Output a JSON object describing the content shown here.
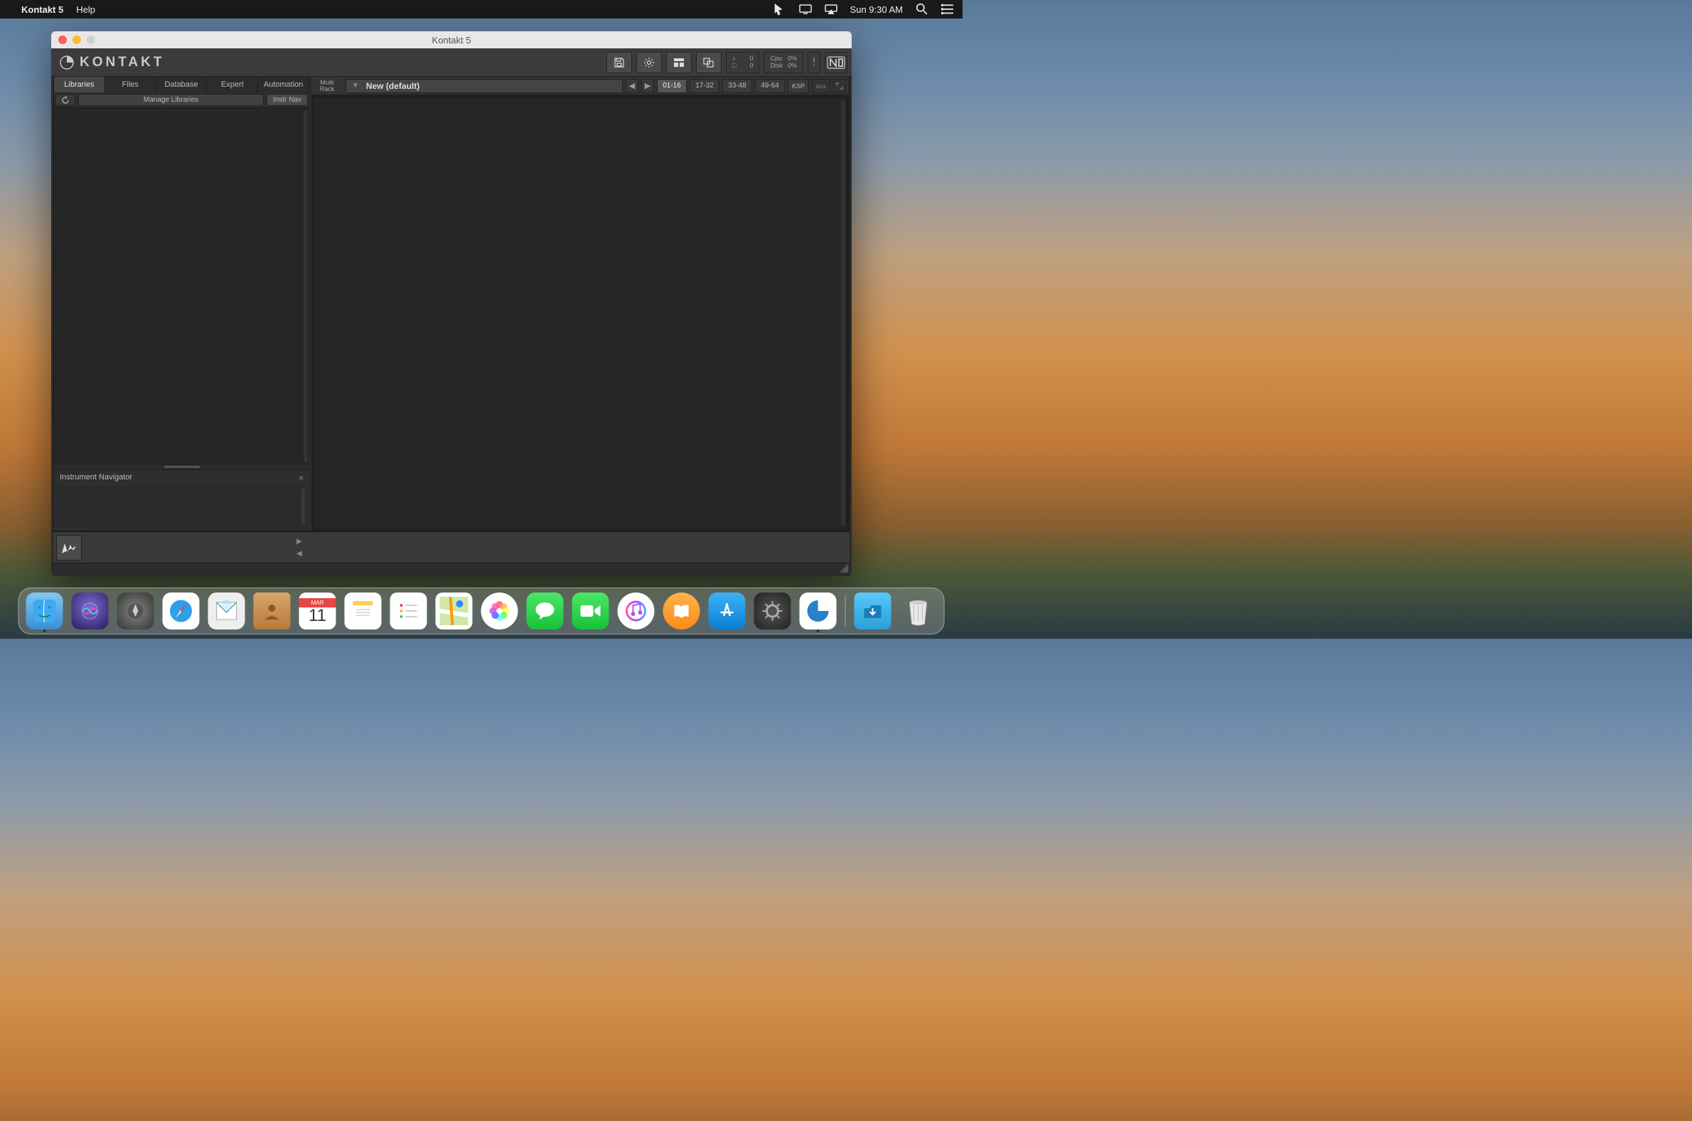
{
  "menubar": {
    "app_name": "Kontakt 5",
    "menu_help": "Help",
    "clock": "Sun 9:30 AM"
  },
  "window": {
    "title": "Kontakt 5"
  },
  "brand": "KONTAKT",
  "header_stats": {
    "notes_label": "♪",
    "notes_value": "0",
    "voices_label": "□",
    "voices_value": "0",
    "cpu_label": "Cpu",
    "cpu_value": "0%",
    "disk_label": "Disk",
    "disk_value": "0%"
  },
  "sidebar": {
    "tabs": {
      "libraries": "Libraries",
      "files": "Files",
      "database": "Database",
      "expert": "Expert",
      "automation": "Automation"
    },
    "manage_libraries": "Manage Libraries",
    "instr_nav_btn": "Instr Nav",
    "instrument_navigator_title": "Instrument Navigator"
  },
  "rack": {
    "label_line1": "Multi",
    "label_line2": "Rack",
    "multi_name": "New (default)",
    "channels": {
      "r1": "01-16",
      "r2": "17-32",
      "r3": "33-48",
      "r4": "49-64"
    },
    "ksp": "KSP",
    "aux": "aux"
  }
}
